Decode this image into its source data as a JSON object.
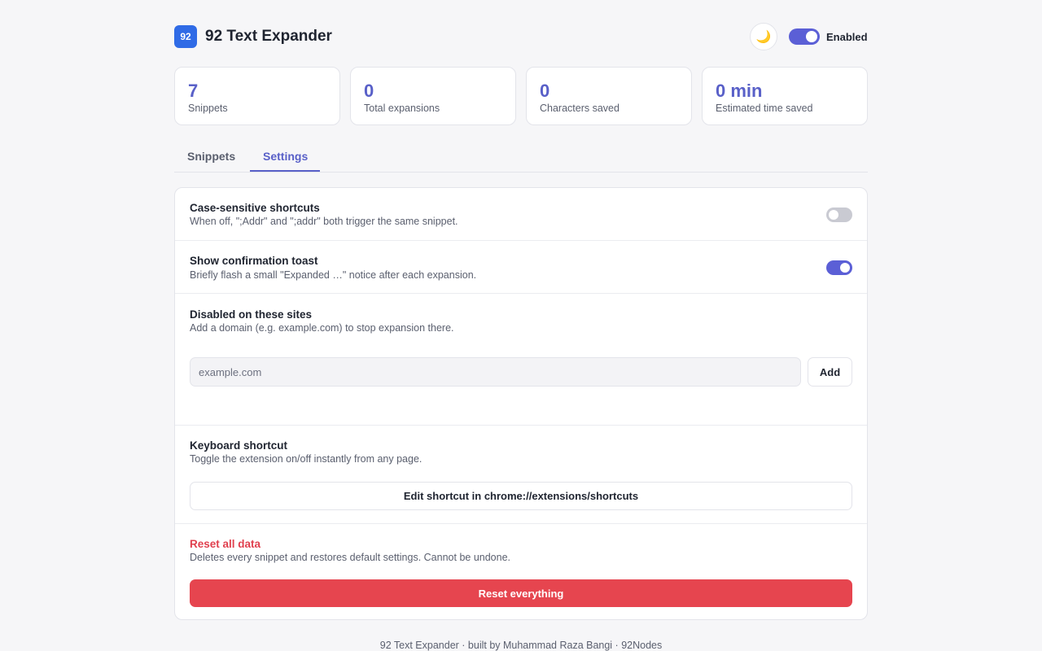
{
  "header": {
    "logo_text": "92",
    "title": "92 Text Expander",
    "theme_icon": "moon-icon",
    "theme_glyph": "🌙",
    "enabled_label": "Enabled",
    "enabled": true
  },
  "stats": [
    {
      "value": "7",
      "label": "Snippets"
    },
    {
      "value": "0",
      "label": "Total expansions"
    },
    {
      "value": "0",
      "label": "Characters saved"
    },
    {
      "value": "0 min",
      "label": "Estimated time saved"
    }
  ],
  "tabs": [
    {
      "label": "Snippets",
      "active": false
    },
    {
      "label": "Settings",
      "active": true
    }
  ],
  "settings": {
    "case_sensitive": {
      "title": "Case-sensitive shortcuts",
      "description": "When off, \";Addr\" and \";addr\" both trigger the same snippet.",
      "enabled": false
    },
    "toast": {
      "title": "Show confirmation toast",
      "description": "Briefly flash a small \"Expanded …\" notice after each expansion.",
      "enabled": true
    },
    "disabled_sites": {
      "title": "Disabled on these sites",
      "description": "Add a domain (e.g. example.com) to stop expansion there.",
      "input_placeholder": "example.com",
      "input_value": "",
      "add_label": "Add"
    },
    "keyboard": {
      "title": "Keyboard shortcut",
      "description": "Toggle the extension on/off instantly from any page.",
      "button_label": "Edit shortcut in chrome://extensions/shortcuts"
    },
    "reset": {
      "title": "Reset all data",
      "description": "Deletes every snippet and restores default settings. Cannot be undone.",
      "button_label": "Reset everything"
    }
  },
  "footer": "92 Text Expander · built by Muhammad Raza Bangi · 92Nodes",
  "colors": {
    "accent": "#5960c8",
    "toggle_on": "#5b5fd6",
    "danger": "#e6454f",
    "logo_bg": "#2f6be6"
  }
}
